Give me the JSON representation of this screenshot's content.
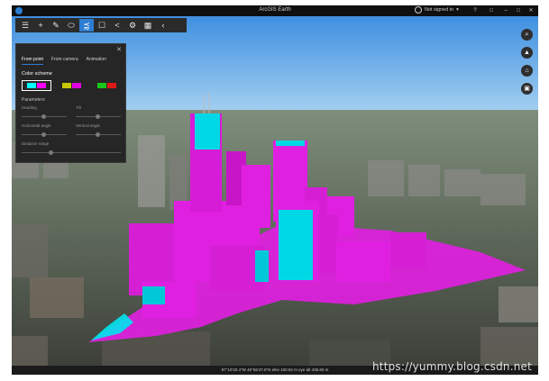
{
  "titlebar": {
    "title": "ArcGIS Earth",
    "user_label": "Not signed in",
    "controls": [
      "?",
      "□",
      "–",
      "□",
      "✕"
    ]
  },
  "toolbar": {
    "tools": [
      {
        "name": "layers-menu-icon",
        "glyph": "☰"
      },
      {
        "name": "add-icon",
        "glyph": "+"
      },
      {
        "name": "draw-icon",
        "glyph": "✎"
      },
      {
        "name": "measure-icon",
        "glyph": "⬭"
      },
      {
        "name": "viewshed-icon",
        "glyph": "⪷",
        "active": true
      },
      {
        "name": "bookmark-icon",
        "glyph": "☐"
      },
      {
        "name": "share-icon",
        "glyph": "<"
      },
      {
        "name": "settings-icon",
        "glyph": "⚙"
      },
      {
        "name": "grid-icon",
        "glyph": "▦"
      },
      {
        "name": "collapse-icon",
        "glyph": "‹"
      }
    ]
  },
  "panel": {
    "close": "✕",
    "tabs": [
      "From point",
      "From camera",
      "Animation"
    ],
    "color_scheme_label": "Color scheme",
    "swatches": [
      {
        "left": "#00ffff",
        "right": "#ff00ff",
        "selected": true
      },
      {
        "left": "#c8c800",
        "right": "#e000e0",
        "selected": false
      },
      {
        "left": "#18c818",
        "right": "#e01818",
        "selected": false
      }
    ],
    "parameters_label": "Parameters",
    "params": {
      "heading": "Heading",
      "tilt": "Tilt",
      "horizontal_angle": "Horizontal angle",
      "vertical_angle": "Vertical angle",
      "distance_range": "Distance range"
    }
  },
  "right_buttons": [
    {
      "name": "search-icon",
      "glyph": "⌕"
    },
    {
      "name": "compass-icon",
      "glyph": "▲"
    },
    {
      "name": "home-icon",
      "glyph": "⌂"
    },
    {
      "name": "basemap-icon",
      "glyph": "▣"
    }
  ],
  "statusbar": {
    "coords": "87°10'20.4\"W 40°56'47.6\"N  elev 100.94 m   eye alt 435.60 m"
  },
  "watermark": "https://yummy.blog.csdn.net",
  "colors": {
    "viewshed_visible": "#00e5ee",
    "viewshed_hidden": "#e020e0",
    "accent": "#2d7dd2"
  }
}
